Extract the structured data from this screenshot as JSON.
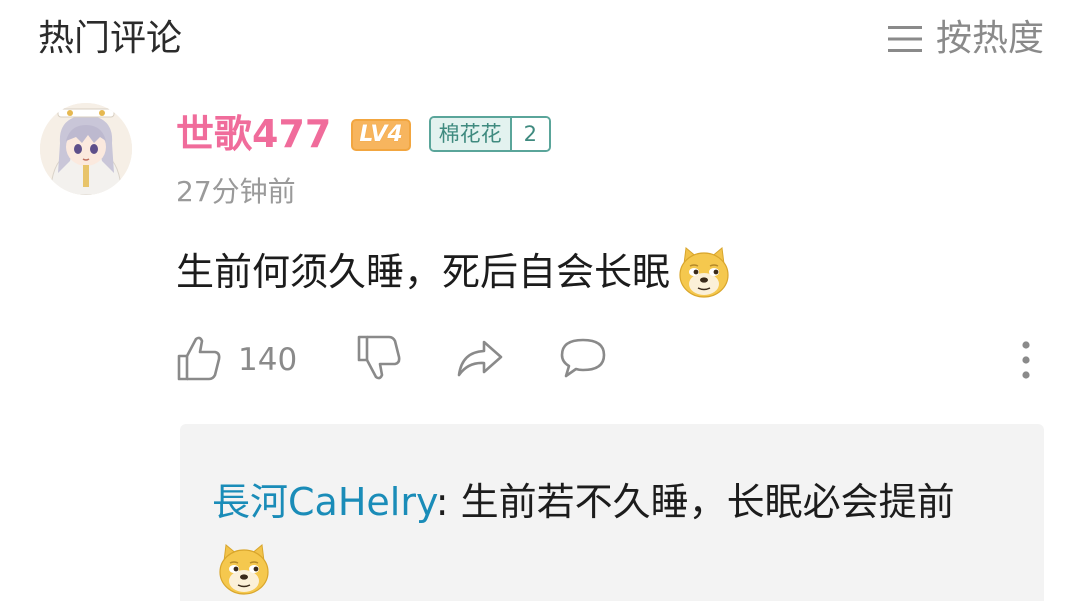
{
  "header": {
    "title": "热门评论",
    "sort_label": "按热度"
  },
  "comment": {
    "username": "世歌477",
    "level": "LV4",
    "fan_badge": {
      "name": "棉花花",
      "level": "2"
    },
    "time": "27分钟前",
    "text": "生前何须久睡，死后自会长眠",
    "emoji": "doge-emoji",
    "likes": "140"
  },
  "reply": {
    "author": "長河CaHelry",
    "separator": ": ",
    "text": "生前若不久睡，长眠必会提前",
    "emoji": "doge-emoji"
  },
  "colors": {
    "username": "#f06c9b",
    "reply_author": "#1a8cb8",
    "level_badge": "#f7b55e",
    "fan_badge": "#5aa59a",
    "reply_bg": "#f3f3f3"
  }
}
